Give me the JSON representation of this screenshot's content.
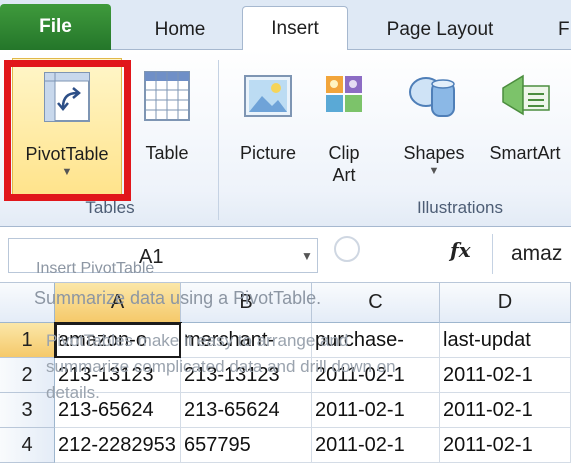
{
  "tabs": {
    "file": "File",
    "home": "Home",
    "insert": "Insert",
    "page_layout": "Page Layout",
    "formulas": "F"
  },
  "ribbon": {
    "tables_group": {
      "label": "Tables",
      "pivot_table": "PivotTable",
      "table": "Table"
    },
    "illustrations_group": {
      "label": "Illustrations",
      "picture": "Picture",
      "clip_art_line1": "Clip",
      "clip_art_line2": "Art",
      "shapes": "Shapes",
      "smartart": "SmartArt"
    }
  },
  "formula_bar": {
    "name_box": "A1",
    "fx_label": "fx",
    "formula_value": "amaz"
  },
  "tooltip": {
    "source": "Insert PivotTable",
    "title": "Summarize data using a PivotTable.",
    "body": "PivotTables make it easy to arrange and summarize complicated data and drill down on details."
  },
  "grid": {
    "columns": [
      "A",
      "B",
      "C",
      "D"
    ],
    "rows": [
      {
        "num": "1",
        "cells": [
          "amazon-o",
          "merchant-",
          "purchase-",
          "last-updat"
        ]
      },
      {
        "num": "2",
        "cells": [
          "213-13123",
          "213-13123",
          "2011-02-1",
          "2011-02-1"
        ]
      },
      {
        "num": "3",
        "cells": [
          "213-65624",
          "213-65624",
          "2011-02-1",
          "2011-02-1"
        ]
      },
      {
        "num": "4",
        "cells": [
          "212-2282953",
          "657795",
          "2011-02-1",
          "2011-02-1"
        ]
      }
    ]
  },
  "colors": {
    "file_tab": "#2e8a34",
    "highlight": "#e1161b",
    "selected_header": "#f5c96a"
  }
}
